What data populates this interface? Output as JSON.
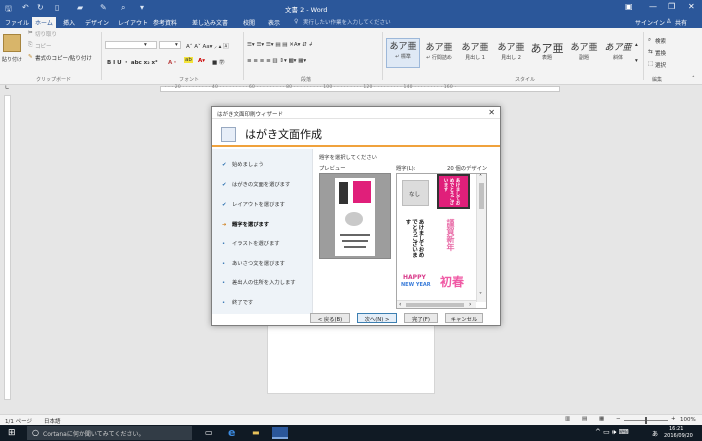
{
  "titlebar": {
    "document_title": "文書 2 - Word",
    "minimize": "—",
    "restore": "❐",
    "close": "✕"
  },
  "tabs": [
    "ファイル",
    "ホーム",
    "挿入",
    "デザイン",
    "レイアウト",
    "参考資料",
    "差し込み文書",
    "校閲",
    "表示"
  ],
  "tell_me": "実行したい作業を入力してください",
  "signin": "サインイン",
  "share": "共有",
  "ribbon": {
    "clipboard": {
      "paste": "貼り付け",
      "cut": "切り取り",
      "copy": "コピー",
      "format_painter": "書式のコピー/貼り付け",
      "label": "クリップボード"
    },
    "font_label": "フォント",
    "paragraph_label": "段落",
    "styles_label": "スタイル",
    "editing_label": "編集",
    "font_size_arrow": "▾",
    "font_row2": "B I U ・ abc x₂ x²",
    "styles": [
      {
        "big": "あア亜",
        "label": "↵ 標準"
      },
      {
        "big": "あア亜",
        "label": "↵ 行間詰め"
      },
      {
        "big": "あア亜",
        "label": "見出し 1"
      },
      {
        "big": "あア亜",
        "label": "見出し 2"
      },
      {
        "big": "あア亜",
        "label": "表題"
      },
      {
        "big": "あア亜",
        "label": "副題"
      },
      {
        "big": "あア亜",
        "label": "斜体"
      }
    ],
    "editing": {
      "search": "検索",
      "replace": "置換",
      "select": "選択"
    }
  },
  "ruler_text": "· · · 20 · · · · · · · · · 40 · · · · · · · · · 60 · · · · · · · · · 80 · · · · · · · · · 100 · · · · · · · · · 120 · · · · · · · · · 140 · · · · · · · · · 160 ·",
  "statusbar": {
    "page": "1/1 ページ",
    "language": "日本語",
    "zoom": "100%"
  },
  "taskbar": {
    "search_placeholder": "Cortanaに何か聞いてみてください。",
    "time": "16:21",
    "date": "2016/09/20",
    "ime": "あ"
  },
  "dialog": {
    "title": "はがき文面印刷ウィザード",
    "header": "はがき文面作成",
    "steps": [
      {
        "mark": "✔",
        "label": "始めましょう",
        "current": false
      },
      {
        "mark": "✔",
        "label": "はがきの文面を選びます",
        "current": false
      },
      {
        "mark": "✔",
        "label": "レイアウトを選びます",
        "current": false
      },
      {
        "mark": "➜",
        "label": "題字を選びます",
        "current": true
      },
      {
        "mark": "•",
        "label": "イラストを選びます",
        "current": false
      },
      {
        "mark": "•",
        "label": "あいさつ文を選びます",
        "current": false
      },
      {
        "mark": "•",
        "label": "差出人の住所を入力します",
        "current": false
      },
      {
        "mark": "•",
        "label": "終了です",
        "current": false
      }
    ],
    "instruction": "題字を選択してください",
    "preview_label": "プレビュー",
    "list_label": "題字(L):",
    "design_count": "20 個のデザイン",
    "none_option": "なし",
    "thumbs": {
      "t1": "あけましておめでとうございます",
      "t2": "謹賀新年",
      "t3": "あけましておめでとうございます",
      "happy": "HAPPY",
      "newyear": "NEW YEAR",
      "shinshun": "初春"
    },
    "buttons": {
      "back": "< 戻る(B)",
      "next": "次へ(N) >",
      "finish": "完了(F)",
      "cancel": "キャンセル"
    }
  }
}
